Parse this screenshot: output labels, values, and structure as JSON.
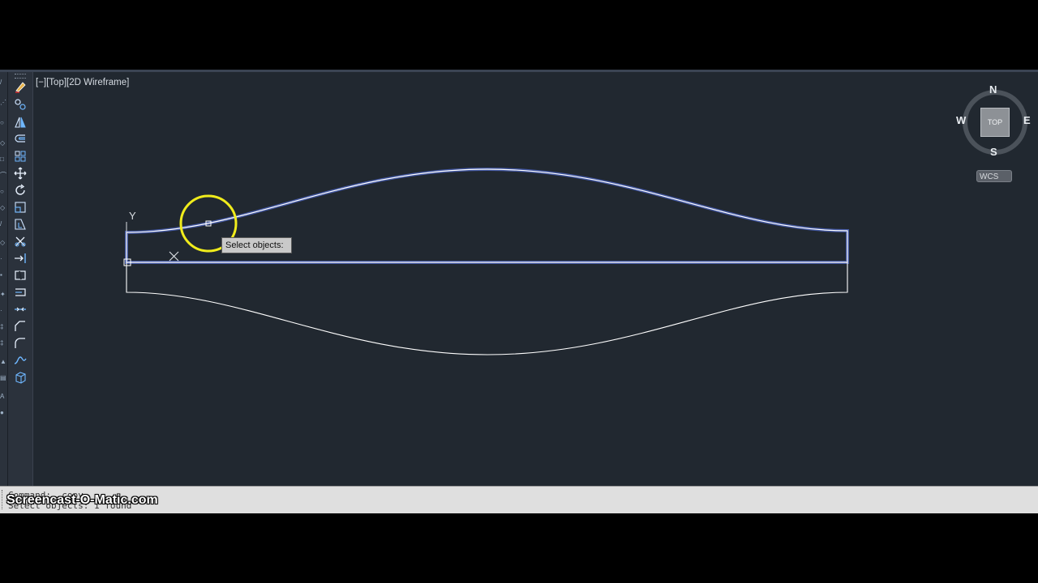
{
  "viewport": {
    "label": "[−][Top][2D Wireframe]",
    "ucs_y_label": "Y"
  },
  "viewcube": {
    "top_face": "TOP",
    "north": "N",
    "south": "S",
    "east": "E",
    "west": "W"
  },
  "wcs_menu": {
    "label": "WCS"
  },
  "tooltip": {
    "text": "Select objects:"
  },
  "command_line": {
    "history_1": "Command: _copy",
    "history_2": "Select objects: 1 found"
  },
  "watermark": {
    "text": "Screencast-O-Matic.com"
  },
  "toolbar_icons": [
    "line-icon",
    "polyline-icon",
    "polygon-icon",
    "rectangle-icon",
    "move-icon",
    "rotate-icon",
    "scale-icon",
    "stretch-icon",
    "trim-icon",
    "extend-icon",
    "break-icon",
    "join-icon",
    "chamfer-icon",
    "fillet-icon",
    "blend-curves-icon",
    "array-icon"
  ],
  "colors": {
    "background": "#212830",
    "selected_highlight": "#6f8fff",
    "geometry": "#ffffff",
    "cursor_circle": "#e8e81a"
  }
}
